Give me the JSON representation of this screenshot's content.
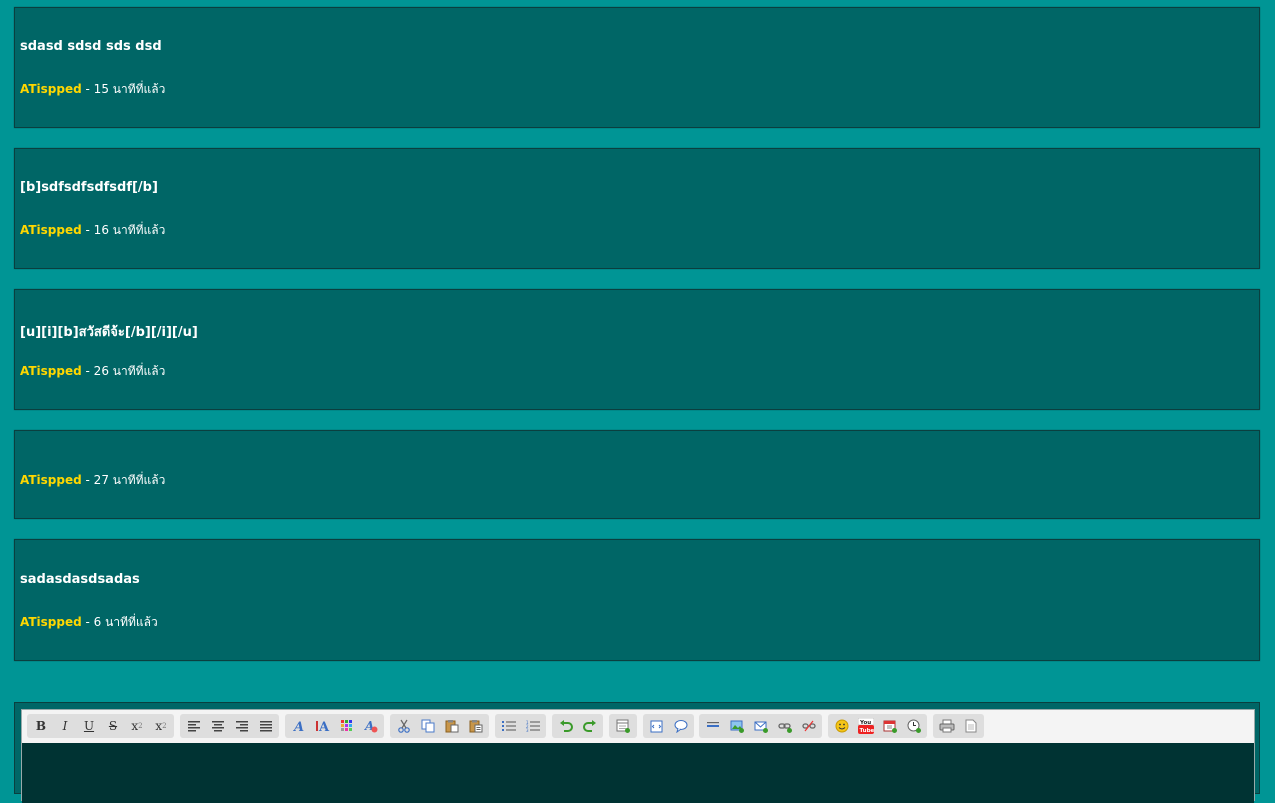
{
  "posts": [
    {
      "title": "sdasd sdsd sds dsd",
      "author": "ATispped",
      "time": " - 15 นาทีที่แล้ว"
    },
    {
      "title": "[b]sdfsdfsdfsdf[/b]",
      "author": "ATispped",
      "time": " - 16 นาทีที่แล้ว"
    },
    {
      "title": "[u][i][b]สวัสดีจ้ะ[/b][/i][/u]",
      "author": "ATispped",
      "time": " - 26 นาทีที่แล้ว"
    },
    {
      "title": "",
      "author": "ATispped",
      "time": " - 27 นาทีที่แล้ว"
    },
    {
      "title": "sadasdasdsadas",
      "author": "ATispped",
      "time": " - 6 นาทีที่แล้ว"
    }
  ],
  "colors": {
    "page_background": "#009595",
    "post_background": "#006666",
    "author": "#ffd700",
    "editor_area": "#003333"
  },
  "toolbar": {
    "bold": "B",
    "italic": "I",
    "underline": "U",
    "strike": "S",
    "subscript": "x",
    "superscript": "x",
    "icons": [
      "bold-icon",
      "italic-icon",
      "underline-icon",
      "strikethrough-icon",
      "subscript-icon",
      "superscript-icon",
      "align-left-icon",
      "align-center-icon",
      "align-right-icon",
      "align-justify-icon",
      "font-icon",
      "font-size-icon",
      "color-icon",
      "remove-format-icon",
      "cut-icon",
      "copy-icon",
      "paste-icon",
      "paste-text-icon",
      "bullet-list-icon",
      "numbered-list-icon",
      "undo-icon",
      "redo-icon",
      "insert-table-icon",
      "code-icon",
      "quote-icon",
      "horizontal-rule-icon",
      "insert-image-icon",
      "email-icon",
      "link-icon",
      "unlink-icon",
      "emoticon-icon",
      "youtube-icon",
      "date-icon",
      "time-icon",
      "print-icon",
      "source-icon"
    ]
  }
}
